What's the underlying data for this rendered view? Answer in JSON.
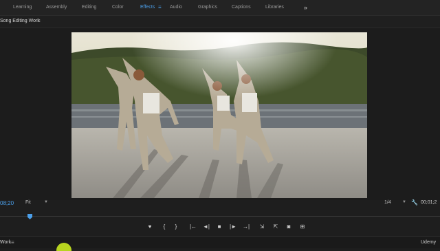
{
  "workspace_tabs": [
    {
      "label": "Learning",
      "active": false
    },
    {
      "label": "Assembly",
      "active": false
    },
    {
      "label": "Editing",
      "active": false
    },
    {
      "label": "Color",
      "active": false
    },
    {
      "label": "Effects",
      "active": true
    },
    {
      "label": "Audio",
      "active": false
    },
    {
      "label": "Graphics",
      "active": false
    },
    {
      "label": "Captions",
      "active": false
    },
    {
      "label": "Libraries",
      "active": false
    }
  ],
  "workspace_menu_glyph": "≡",
  "workspace_more_glyph": "»",
  "program_monitor": {
    "title": "Song Editing Work",
    "menu_glyph": "≡"
  },
  "controls": {
    "timecode_in": "08;20",
    "fit_label": "Fit",
    "resolution_label": "1/4",
    "timecode_out": "00;01;2"
  },
  "transport": {
    "marker": "♥",
    "mark_in": "{",
    "mark_out": "}",
    "go_to_in": "|←",
    "step_back": "◄|",
    "stop": "■",
    "step_forward": "|►",
    "go_to_out": "→|",
    "insert": "⇲",
    "overwrite": "⇱",
    "export_frame": "◙",
    "settings": "⊞"
  },
  "timeline_panel": {
    "title": "Work",
    "menu_glyph": "≡"
  },
  "watermark": "Udemy",
  "colors": {
    "accent": "#4b9fea",
    "panel_bg": "#1e1e1e",
    "text": "#9a9a9a",
    "blob": "#b7d41f"
  }
}
